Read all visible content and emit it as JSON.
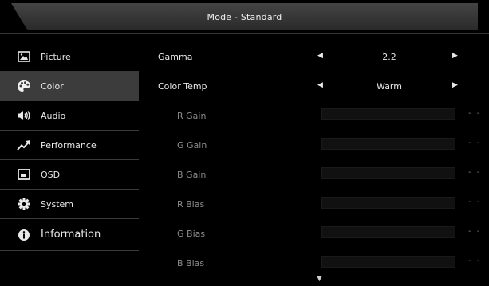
{
  "header": {
    "title": "Mode - Standard"
  },
  "sidebar": {
    "items": [
      {
        "label": "Picture",
        "icon": "picture-icon",
        "active": false
      },
      {
        "label": "Color",
        "icon": "palette-icon",
        "active": true
      },
      {
        "label": "Audio",
        "icon": "speaker-icon",
        "active": false
      },
      {
        "label": "Performance",
        "icon": "trend-arrow-icon",
        "active": false
      },
      {
        "label": "OSD",
        "icon": "osd-window-icon",
        "active": false
      },
      {
        "label": "System",
        "icon": "gear-icon",
        "active": false
      },
      {
        "label": "Information",
        "icon": "info-icon",
        "active": false
      }
    ]
  },
  "settings": {
    "gamma": {
      "label": "Gamma",
      "value": "2.2"
    },
    "color_temp": {
      "label": "Color Temp",
      "value": "Warm"
    },
    "sliders": [
      {
        "label": "R Gain",
        "value": "- -",
        "level": 0
      },
      {
        "label": "G Gain",
        "value": "- -",
        "level": 0
      },
      {
        "label": "B Gain",
        "value": "- -",
        "level": 0
      },
      {
        "label": "R Bias",
        "value": "- -",
        "level": 0
      },
      {
        "label": "G Bias",
        "value": "- -",
        "level": 0
      },
      {
        "label": "B Bias",
        "value": "- -",
        "level": 0
      }
    ]
  },
  "colors": {
    "background": "#000000",
    "active_item": "#3c3c3c",
    "text": "#e8e8e8",
    "dim_text": "#8c8c8c"
  },
  "icons": {
    "left_arrow": "◀",
    "right_arrow": "▶",
    "scroll_down": "▼"
  }
}
